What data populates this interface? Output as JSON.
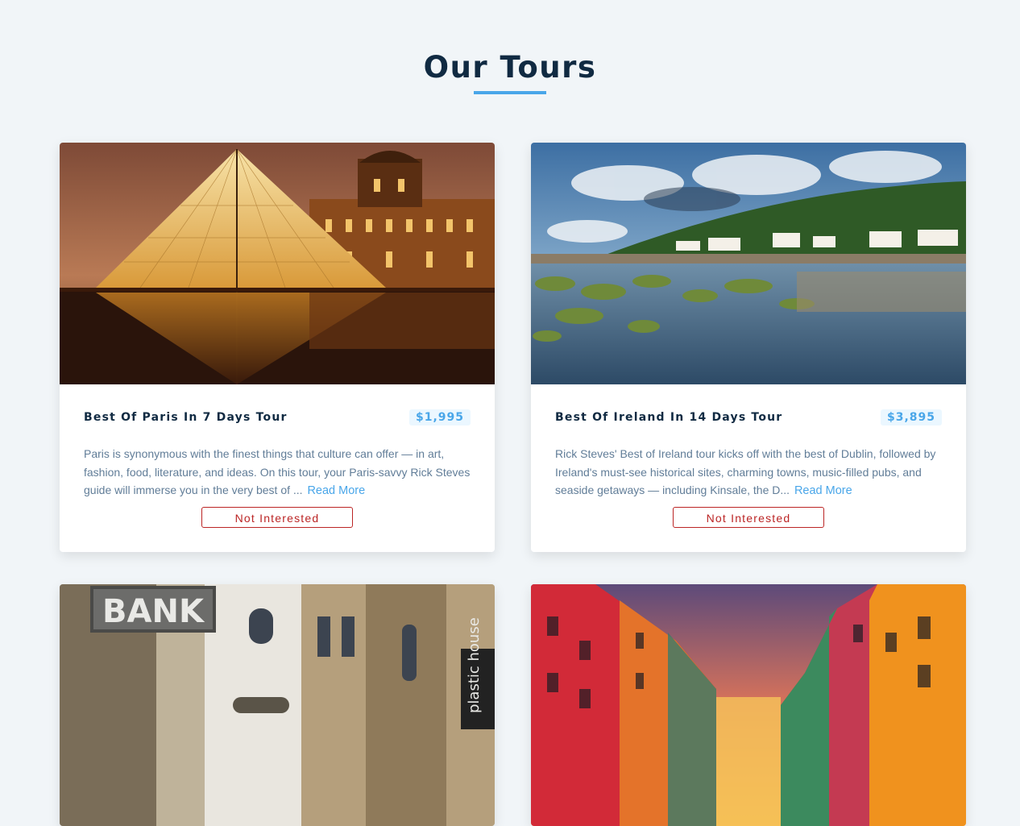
{
  "page": {
    "title": "Our Tours",
    "accent_color": "#49a6e9",
    "danger_color": "#bb2525"
  },
  "tours": [
    {
      "name": "Best Of Paris In 7 Days Tour",
      "price": "$1,995",
      "description": "Paris is synonymous with the finest things that culture can offer — in art, fashion, food, literature, and ideas. On this tour, your Paris-savvy Rick Steves guide will immerse you in the very best of ...",
      "read_more": "Read More",
      "not_interested": "Not Interested",
      "image": "louvre-pyramid-night-photo"
    },
    {
      "name": "Best Of Ireland In 14 Days Tour",
      "price": "$3,895",
      "description": "Rick Steves' Best of Ireland tour kicks off with the best of Dublin, followed by Ireland's must-see historical sites, charming towns, music-filled pubs, and seaside getaways — including Kinsale, the D...",
      "read_more": "Read More",
      "not_interested": "Not Interested",
      "image": "irish-coast-mossy-rocks-photo"
    },
    {
      "image": "vienna-street-bank-sign-photo",
      "sign_text": "BANK",
      "shop_sign": "plastic house"
    },
    {
      "image": "colorful-venice-canal-sunset-photo"
    }
  ]
}
